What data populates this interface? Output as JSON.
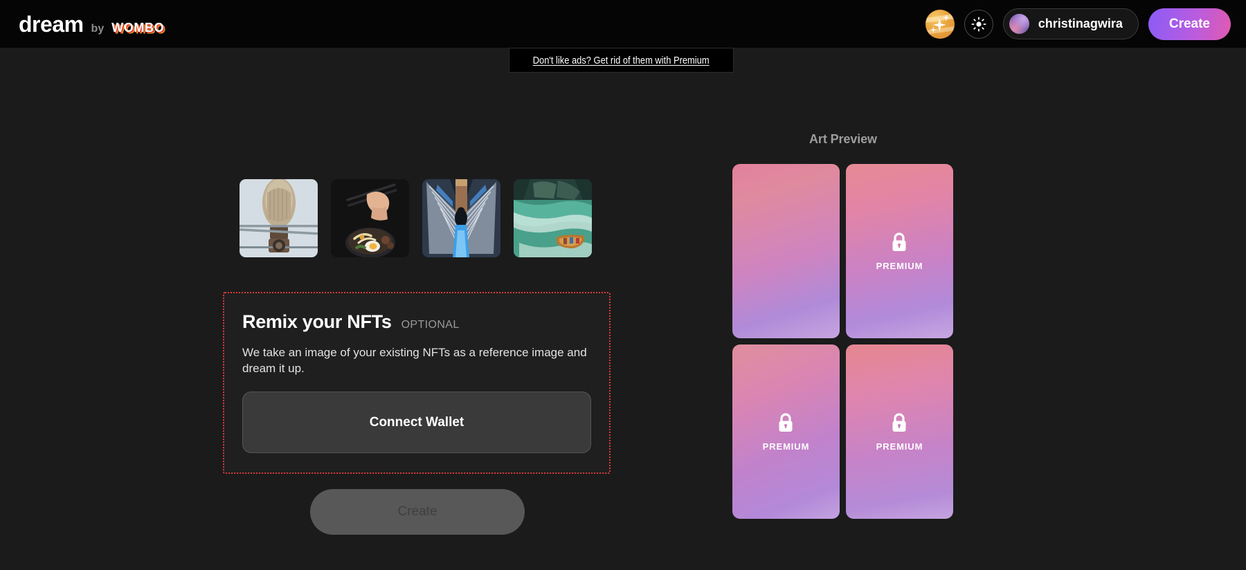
{
  "topbar": {
    "brand_name": "dream",
    "brand_by": "by",
    "brand_partner": "WOMBO",
    "sparkle_icon": "sparkle-icon",
    "theme_icon": "sun-brightness-icon",
    "username": "christinagwira",
    "create_label": "Create"
  },
  "ad_banner": {
    "text": "Don't like ads? Get rid of them with Premium"
  },
  "thumbnails": [
    {
      "name": "owl-on-post-thumbnail"
    },
    {
      "name": "chopsticks-food-bowl-thumbnail"
    },
    {
      "name": "escalator-subway-thumbnail"
    },
    {
      "name": "boat-on-lake-thumbnail"
    }
  ],
  "nft_section": {
    "title": "Remix your NFTs",
    "optional_badge": "OPTIONAL",
    "description": "We take an image of your existing NFTs as a reference image and dream it up.",
    "connect_wallet_label": "Connect Wallet",
    "border_color": "#e03a3a"
  },
  "create_main": {
    "label": "Create",
    "disabled": true
  },
  "art_preview": {
    "title": "Art Preview",
    "lock_icon": "lock-icon",
    "cards": [
      {
        "premium": false,
        "label": ""
      },
      {
        "premium": true,
        "label": "PREMIUM"
      },
      {
        "premium": true,
        "label": "PREMIUM"
      },
      {
        "premium": true,
        "label": "PREMIUM"
      }
    ]
  },
  "colors": {
    "background": "#1b1b1b",
    "topbar": "#050505",
    "accent_create": "#b85ce0",
    "nft_border": "#e03a3a"
  }
}
